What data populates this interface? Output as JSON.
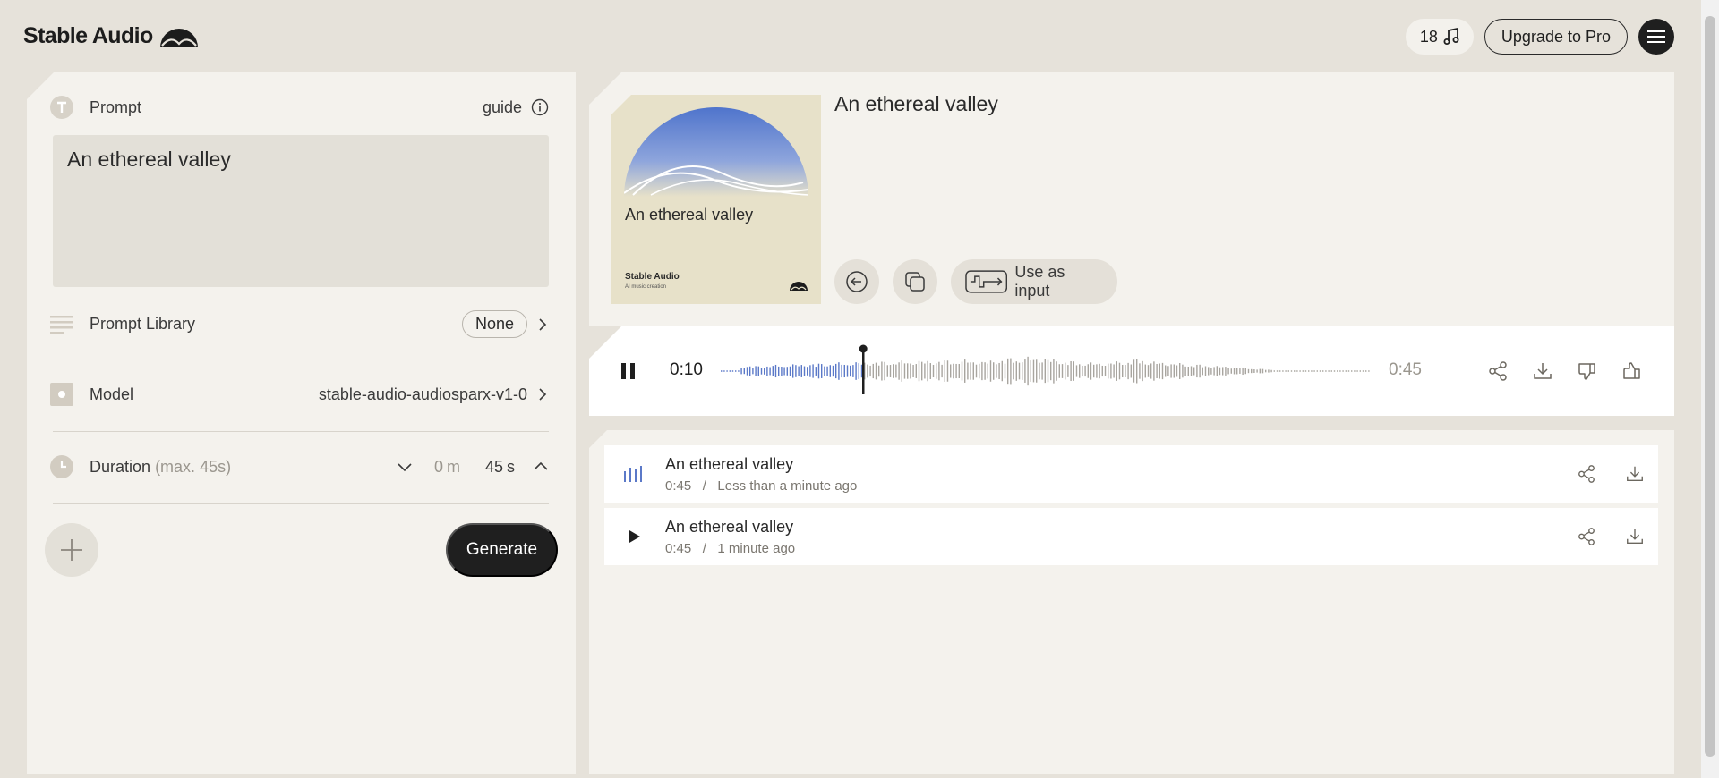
{
  "header": {
    "logo": "Stable Audio",
    "credits": "18",
    "upgrade_label": "Upgrade to Pro"
  },
  "left": {
    "prompt_label": "Prompt",
    "guide_label": "guide",
    "prompt_text": "An ethereal valley",
    "library_label": "Prompt Library",
    "library_value": "None",
    "model_label": "Model",
    "model_value": "stable-audio-audiosparx-v1-0",
    "duration_label": "Duration",
    "duration_hint": "(max. 45s)",
    "duration_minutes": "0",
    "duration_minutes_unit": "m",
    "duration_seconds": "45",
    "duration_seconds_unit": "s",
    "generate_label": "Generate"
  },
  "track": {
    "title": "An ethereal valley",
    "art_title": "An ethereal valley",
    "art_brand": "Stable Audio",
    "art_sub": "AI music creation",
    "use_as_input_label": "Use as input"
  },
  "player": {
    "current_time": "0:10",
    "total_time": "0:45",
    "progress": 0.22
  },
  "history": [
    {
      "title": "An ethereal valley",
      "duration": "0:45",
      "sep": "/",
      "when": "Less than a minute ago",
      "state": "playing"
    },
    {
      "title": "An ethereal valley",
      "duration": "0:45",
      "sep": "/",
      "when": "1 minute ago",
      "state": "paused"
    }
  ],
  "colors": {
    "accent_blue": "#5b79c8",
    "dark": "#1f1f1f",
    "panel": "#f4f2ed",
    "background": "#e6e2da"
  }
}
